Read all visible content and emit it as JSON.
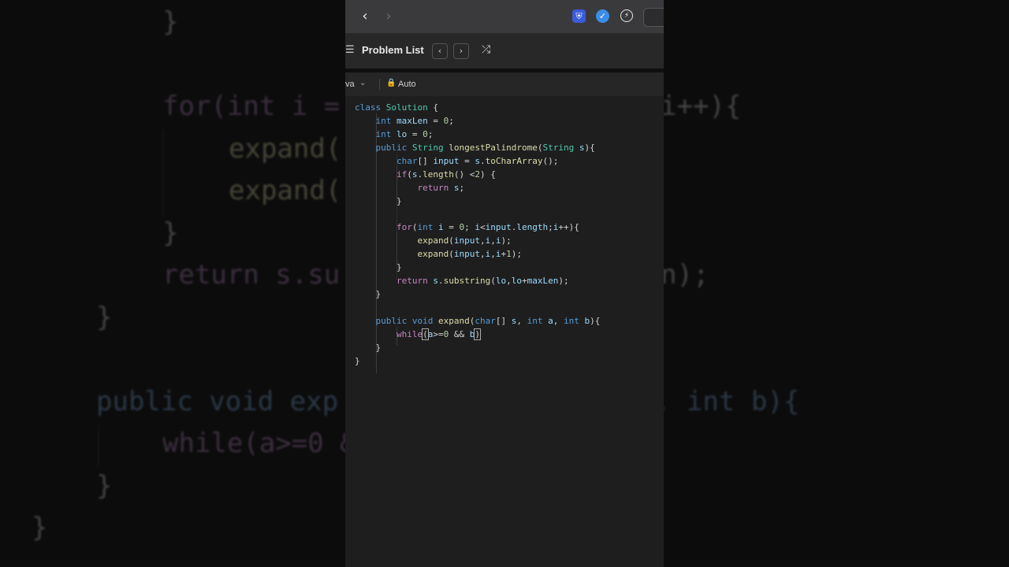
{
  "browser": {
    "back_glyph": "‹",
    "forward_glyph": "›",
    "extensions": [
      {
        "name": "shield-icon",
        "color": "#3b5bdb",
        "glyph": "⛨"
      },
      {
        "name": "verified-icon",
        "color": "#3a8ee6",
        "glyph": "✓"
      },
      {
        "name": "lightning-icon",
        "color": "#5a5a5c",
        "glyph": "⚡"
      }
    ]
  },
  "toolbar": {
    "title": "Problem List",
    "prev_glyph": "‹",
    "next_glyph": "›",
    "shuffle_glyph": "⤮"
  },
  "editor": {
    "language": "va",
    "mode": "Auto"
  },
  "code_lines": [
    "class Solution {",
    "    int maxLen = 0;",
    "    int lo = 0;",
    "    public String longestPalindrome(String s){",
    "        char[] input = s.toCharArray();",
    "        if(s.length() <2) {",
    "            return s;",
    "        }",
    "",
    "        for(int i = 0; i<input.length;i++){",
    "            expand(input,i,i);",
    "            expand(input,i,i+1);",
    "        }",
    "        return s.substring(lo,lo+maxLen);",
    "    }",
    "",
    "    public void expand(char[] s, int a, int b){",
    "        while(a>=0 && b)",
    "    }",
    "}"
  ],
  "background_lines_left": [
    "}",
    "for(int i =",
    "expand(",
    "expand(",
    "}",
    "return s.su",
    "}",
    "public void exp",
    "while(a>=0 &",
    "}",
    "}"
  ],
  "background_lines_right": [
    "i++){",
    "n);",
    ", int b){"
  ],
  "colors": {
    "keyword": "#569cd6",
    "type": "#4ec9b0",
    "function": "#dcdcaa",
    "variable": "#9cdcfe",
    "number": "#b5cea8",
    "control": "#c586c0"
  }
}
